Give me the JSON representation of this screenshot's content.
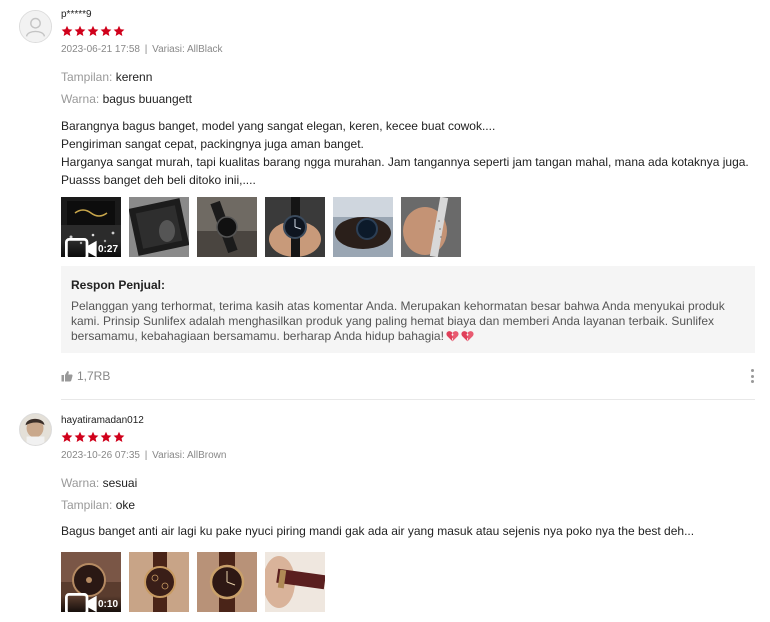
{
  "reviews": [
    {
      "username": "p*****9",
      "rating": 5,
      "date": "2023-06-21 17:58",
      "separator": "|",
      "variant": "Variasi: AllBlack",
      "attributes": [
        {
          "key": "Tampilan:",
          "value": "kerenn"
        },
        {
          "key": "Warna:",
          "value": "bagus buuangett"
        }
      ],
      "body_lines": [
        "Barangnya bagus banget, model yang sangat elegan, keren, kecee buat cowok....",
        "Pengiriman sangat cepat, packingnya juga aman banget.",
        "Harganya sangat murah, tapi kualitas barang ngga murahan. Jam tangannya seperti jam tangan mahal, mana ada kotaknya juga.",
        "Puasss banget deh beli ditoko inii,...."
      ],
      "video_duration": "0:27",
      "seller_response": {
        "title": "Respon Penjual:",
        "text": "Pelanggan yang terhormat, terima kasih atas komentar Anda. Merupakan kehormatan besar bahwa Anda menyukai produk kami. Prinsip Sunlifex adalah menghasilkan produk yang paling hemat biaya dan memberi Anda layanan terbaik. Sunlifex bersamamu, kebahagiaan bersamamu. berharap Anda hidup bahagia!"
      },
      "likes": "1,7RB"
    },
    {
      "username": "hayatiramadan012",
      "rating": 5,
      "date": "2023-10-26 07:35",
      "separator": "|",
      "variant": "Variasi: AllBrown",
      "attributes": [
        {
          "key": "Warna:",
          "value": "sesuai"
        },
        {
          "key": "Tampilan:",
          "value": "oke"
        }
      ],
      "body_lines": [
        "Bagus banget anti air lagi ku pake nyuci piring mandi gak ada air yang masuk atau sejenis nya poko nya the best deh..."
      ],
      "video_duration": "0:10"
    }
  ],
  "colors": {
    "star": "#d0011b",
    "heart": "#e0405a",
    "muted": "#888888",
    "seller_bg": "#f5f5f5"
  },
  "icons": {
    "star": "star-icon",
    "video": "video-camera-icon",
    "like": "thumbs-up-icon",
    "more": "more-vertical-icon",
    "heart": "broken-heart-emoji"
  }
}
